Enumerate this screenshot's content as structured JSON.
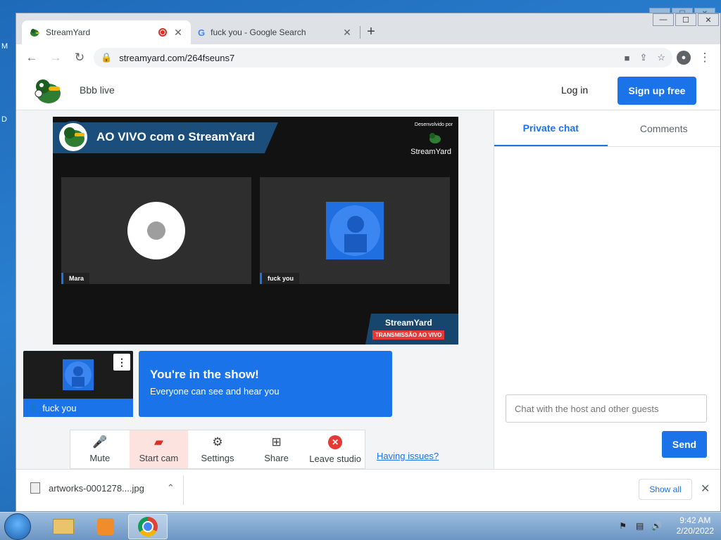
{
  "desktop": {
    "frag1": "M",
    "frag2": "D"
  },
  "window_controls": {
    "min": "—",
    "max": "☐",
    "close": "✕"
  },
  "tabs": [
    {
      "title": "StreamYard",
      "close": "✕"
    },
    {
      "title": "fuck you - Google Search",
      "close": "✕"
    }
  ],
  "new_tab": "+",
  "toolbar": {
    "url": "streamyard.com/264fseuns7"
  },
  "header": {
    "stream_name": "Bbb live",
    "login": "Log in",
    "signup": "Sign up free"
  },
  "stage": {
    "banner_text": "AO VIVO com o StreamYard",
    "dev_by": "Desenvolvido por",
    "dev_brand": "StreamYard",
    "participants": [
      {
        "name": "Mara"
      },
      {
        "name": "fuck you"
      }
    ],
    "corner_title": "StreamYard",
    "corner_sub": "TRANSMISSÃO AO VIVO"
  },
  "self_preview": {
    "name": "fuck you"
  },
  "inshow": {
    "title": "You're in the show!",
    "subtitle": "Everyone can see and hear you"
  },
  "controls": [
    {
      "label": "Mute",
      "icon": "mic-icon"
    },
    {
      "label": "Start cam",
      "icon": "camera-off-icon"
    },
    {
      "label": "Settings",
      "icon": "gear-icon"
    },
    {
      "label": "Share",
      "icon": "screen-share-icon"
    },
    {
      "label": "Leave studio",
      "icon": "leave-icon"
    }
  ],
  "issues_link": "Having issues?",
  "side": {
    "tabs": [
      {
        "label": "Private chat"
      },
      {
        "label": "Comments"
      }
    ],
    "chat_placeholder": "Chat with the host and other guests",
    "send": "Send"
  },
  "downloads": {
    "file": "artworks-0001278....jpg",
    "show_all": "Show all"
  },
  "taskbar": {
    "time": "9:42 AM",
    "date": "2/20/2022"
  },
  "colors": {
    "accent": "#1a73e8",
    "danger": "#e53935",
    "stage_bg": "#121212"
  }
}
